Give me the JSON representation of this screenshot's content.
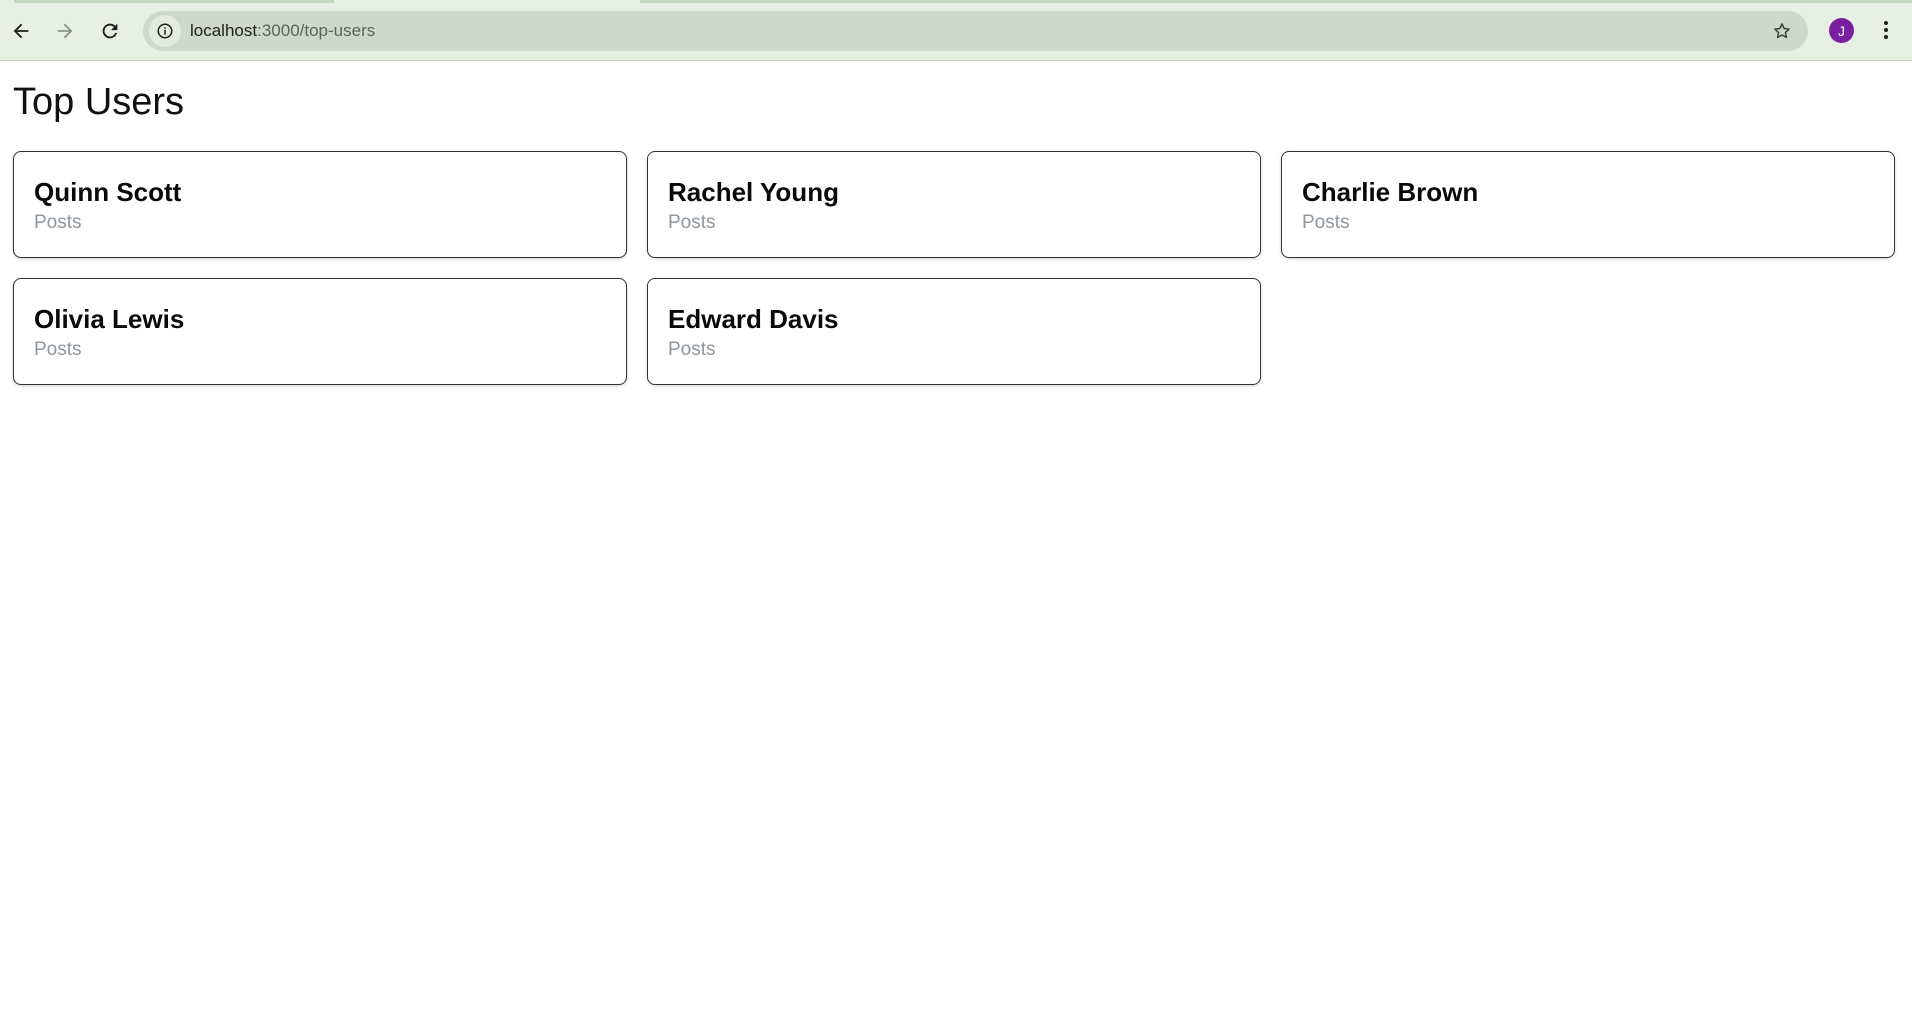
{
  "browser": {
    "url_host": "localhost",
    "url_path": ":3000/top-users",
    "profile_initial": "J",
    "icons": {
      "back": "arrow-left-icon",
      "forward": "arrow-right-icon",
      "reload": "reload-icon",
      "site_info": "info-icon",
      "bookmark": "star-icon",
      "menu": "vertical-dots-icon"
    }
  },
  "page": {
    "title": "Top Users",
    "users": [
      {
        "name": "Quinn Scott",
        "subtitle": "Posts"
      },
      {
        "name": "Rachel Young",
        "subtitle": "Posts"
      },
      {
        "name": "Charlie Brown",
        "subtitle": "Posts"
      },
      {
        "name": "Olivia Lewis",
        "subtitle": "Posts"
      },
      {
        "name": "Edward Davis",
        "subtitle": "Posts"
      }
    ]
  },
  "colors": {
    "chrome_background": "#e8f0e3",
    "omnibox_background": "#cfd8cc",
    "avatar": "#7b1fa2",
    "card_border": "#333333",
    "subtitle_text": "#8f969c"
  }
}
